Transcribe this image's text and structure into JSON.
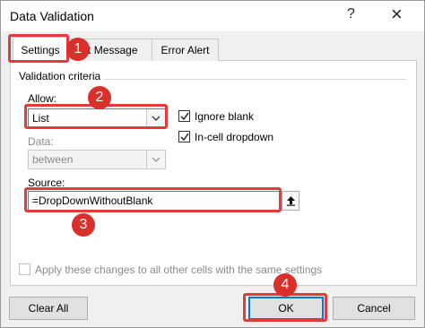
{
  "window": {
    "title": "Data Validation",
    "help_glyph": "?",
    "close_glyph": "×"
  },
  "tabs": [
    {
      "label": "Settings"
    },
    {
      "label": "ut Message"
    },
    {
      "label": "Error Alert"
    }
  ],
  "settings": {
    "group_label": "Validation criteria",
    "allow_label": "Allow:",
    "allow_value": "List",
    "data_label": "Data:",
    "data_value": "between",
    "ignore_blank_label": "Ignore blank",
    "ignore_blank_checked": true,
    "in_cell_dropdown_label": "In-cell dropdown",
    "in_cell_dropdown_checked": true,
    "source_label": "Source:",
    "source_value": "=DropDownWithoutBlank",
    "apply_label": "Apply these changes to all other cells with the same settings"
  },
  "buttons": {
    "clear_all": "Clear All",
    "ok": "OK",
    "cancel": "Cancel"
  },
  "callouts": [
    "1",
    "2",
    "3",
    "4"
  ],
  "colors": {
    "highlight": "#e23b3b",
    "badge": "#d9302c",
    "focus": "#0078d7"
  }
}
